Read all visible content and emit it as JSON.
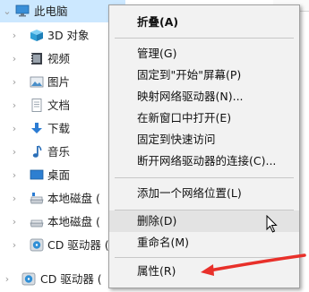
{
  "tree": {
    "items": [
      {
        "label": "此电脑",
        "icon": "computer-icon"
      },
      {
        "label": "3D 对象",
        "icon": "3d-objects-icon"
      },
      {
        "label": "视频",
        "icon": "video-folder-icon"
      },
      {
        "label": "图片",
        "icon": "pictures-folder-icon"
      },
      {
        "label": "文档",
        "icon": "documents-folder-icon"
      },
      {
        "label": "下载",
        "icon": "downloads-folder-icon"
      },
      {
        "label": "音乐",
        "icon": "music-folder-icon"
      },
      {
        "label": "桌面",
        "icon": "desktop-folder-icon"
      },
      {
        "label": "本地磁盘 (",
        "icon": "local-disk-icon"
      },
      {
        "label": "本地磁盘 (",
        "icon": "local-disk-icon"
      },
      {
        "label": "CD 驱动器 (",
        "icon": "cd-drive-icon"
      },
      {
        "label": "CD 驱动器 (",
        "icon": "cd-drive-icon"
      }
    ]
  },
  "context_menu": {
    "items": [
      {
        "label": "折叠(A)"
      },
      {
        "label": "管理(G)"
      },
      {
        "label": "固定到\"开始\"屏幕(P)"
      },
      {
        "label": "映射网络驱动器(N)..."
      },
      {
        "label": "在新窗口中打开(E)"
      },
      {
        "label": "固定到快速访问"
      },
      {
        "label": "断开网络驱动器的连接(C)..."
      },
      {
        "label": "添加一个网络位置(L)"
      },
      {
        "label": "删除(D)"
      },
      {
        "label": "重命名(M)"
      },
      {
        "label": "属性(R)"
      }
    ]
  },
  "colors": {
    "selection": "#cce8ff",
    "menu_background": "#f2f2f2",
    "annotation_arrow": "#e8302a"
  }
}
